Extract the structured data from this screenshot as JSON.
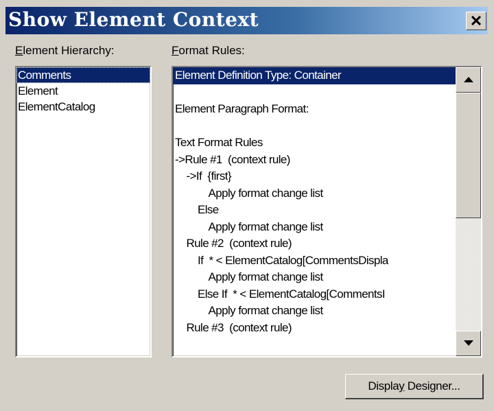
{
  "window": {
    "title": "Show Element Context",
    "close_icon": "close-icon"
  },
  "hierarchy": {
    "label_accel": "E",
    "label_rest": "lement Hierarchy:",
    "items": [
      {
        "label": "Comments",
        "selected": true
      },
      {
        "label": "Element",
        "selected": false
      },
      {
        "label": "ElementCatalog",
        "selected": false
      }
    ]
  },
  "rules": {
    "label_accel": "F",
    "label_rest": "ormat Rules:",
    "lines": [
      "Element Definition Type: Container",
      "",
      "Element Paragraph Format:",
      "",
      "Text Format Rules",
      "->Rule #1  (context rule)",
      "    ->If  {first}",
      "            Apply format change list",
      "        Else",
      "            Apply format change list",
      "    Rule #2  (context rule)",
      "        If  * < ElementCatalog[CommentsDispla",
      "            Apply format change list",
      "        Else If  * < ElementCatalog[CommentsI",
      "            Apply format change list",
      "    Rule #3  (context rule)"
    ]
  },
  "buttons": {
    "display_designer_pre": "Displa",
    "display_designer_accel": "y",
    "display_designer_post": " Designer..."
  }
}
